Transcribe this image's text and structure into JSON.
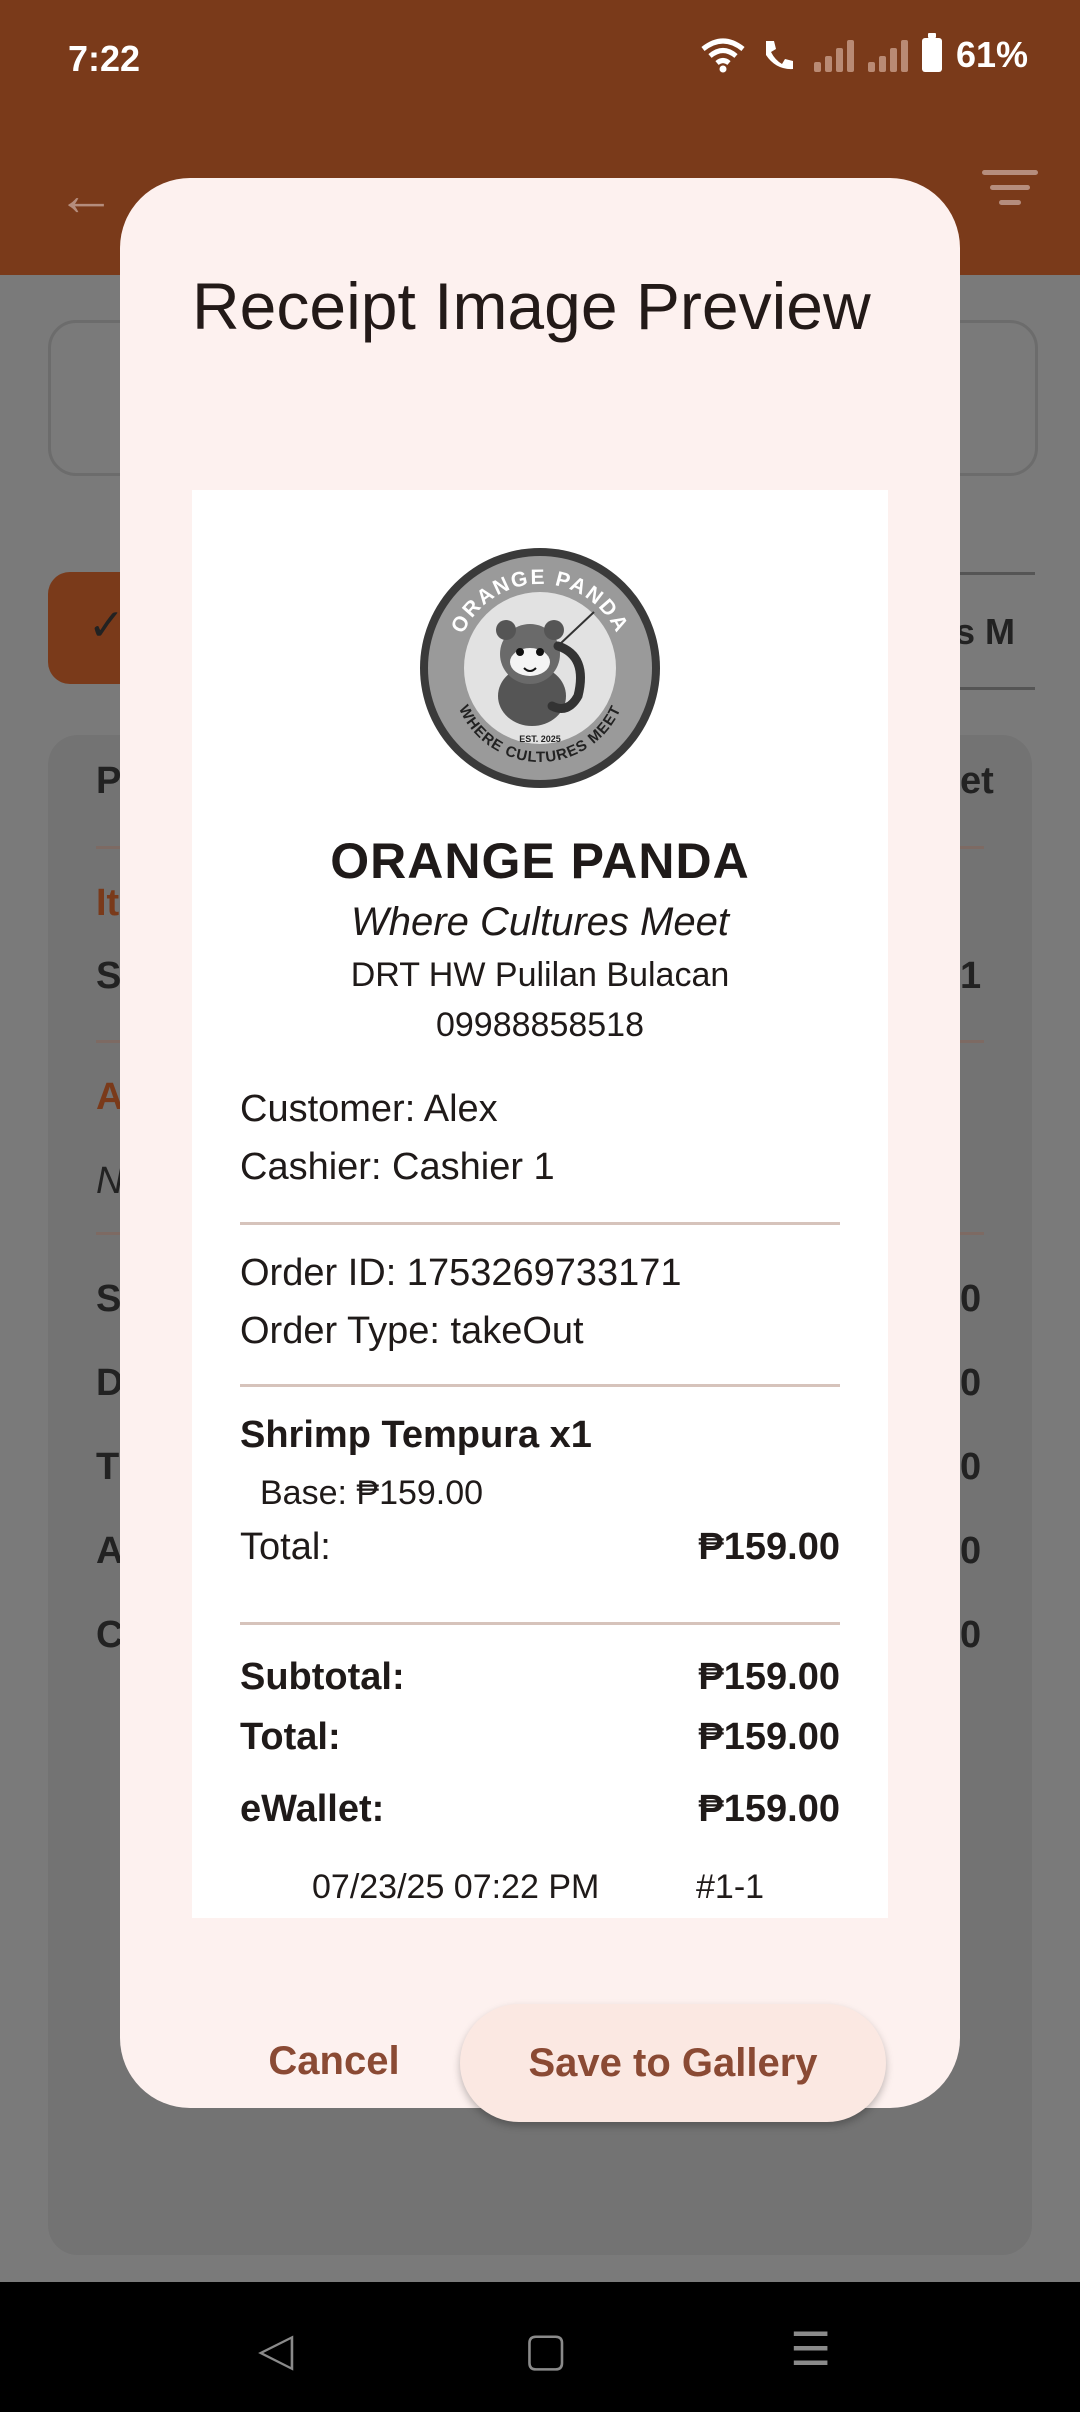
{
  "status_bar": {
    "time": "7:22",
    "battery": "61%"
  },
  "dialog": {
    "title": "Receipt Image Preview",
    "cancel_label": "Cancel",
    "save_label": "Save to Gallery"
  },
  "receipt": {
    "logo": {
      "top_text": "ORANGE PANDA",
      "bottom_text": "WHERE CULTURES MEET",
      "est": "EST. 2025"
    },
    "store_name": "ORANGE PANDA",
    "tagline": "Where Cultures Meet",
    "address": "DRT HW Pulilan Bulacan",
    "phone": "09988858518",
    "customer": "Customer: Alex",
    "cashier": "Cashier: Cashier 1",
    "order_id": "Order ID: 1753269733171",
    "order_type": "Order Type: takeOut",
    "item": {
      "name": "Shrimp Tempura x1",
      "base": "Base: ₱159.00",
      "total_label": "Total:",
      "total_value": "₱159.00"
    },
    "subtotal_label": "Subtotal:",
    "subtotal_value": "₱159.00",
    "total_label": "Total:",
    "total_value": "₱159.00",
    "payment_label": "eWallet:",
    "payment_value": "₱159.00",
    "datetime": "07/23/25 07:22 PM",
    "ticket": "#1-1"
  },
  "background": {
    "chip_right_text": "is M",
    "row_letters_left": [
      "P",
      "It",
      "S",
      "A",
      "N",
      "S",
      "D",
      "T",
      "A",
      "C"
    ],
    "row_letters_right": [
      "et",
      "1",
      "0",
      "0",
      "0",
      "0",
      "0"
    ]
  },
  "colors": {
    "brand": "#7a3a1a",
    "dialog_bg": "#fdf1ef",
    "button_text": "#8a4a34",
    "save_bg": "#fbe8e2"
  }
}
